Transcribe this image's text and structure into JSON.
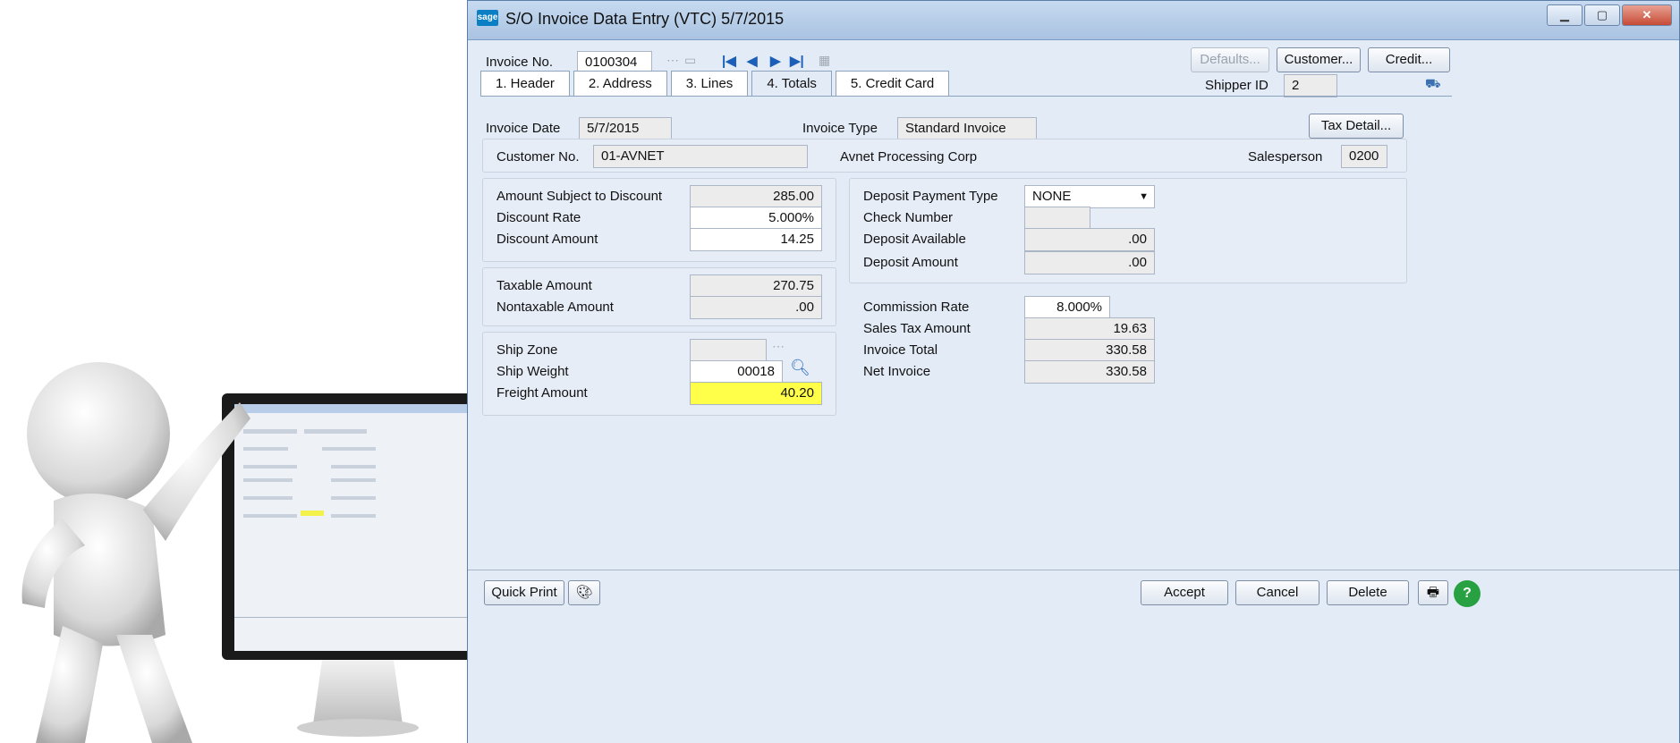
{
  "window": {
    "logo": "sage",
    "title": "S/O Invoice Data Entry (VTC) 5/7/2015",
    "minimize_icon": "minimize-icon",
    "maximize_icon": "maximize-icon",
    "close_icon": "close-icon"
  },
  "invoice": {
    "label": "Invoice No.",
    "value": "0100304"
  },
  "buttons": {
    "defaults": "Defaults...",
    "customer": "Customer...",
    "credit": "Credit...",
    "tax_detail": "Tax Detail..."
  },
  "shipper": {
    "label": "Shipper ID",
    "value": "2"
  },
  "tabs": [
    {
      "label": "1. Header"
    },
    {
      "label": "2. Address"
    },
    {
      "label": "3. Lines"
    },
    {
      "label": "4. Totals",
      "active": true
    },
    {
      "label": "5. Credit Card"
    }
  ],
  "header_info": {
    "invoice_date_label": "Invoice Date",
    "invoice_date": "5/7/2015",
    "invoice_type_label": "Invoice Type",
    "invoice_type": "Standard Invoice",
    "customer_no_label": "Customer No.",
    "customer_no": "01-AVNET",
    "customer_name": "Avnet Processing Corp",
    "salesperson_label": "Salesperson",
    "salesperson": "0200"
  },
  "discount": {
    "amount_subject_label": "Amount Subject to Discount",
    "amount_subject": "285.00",
    "rate_label": "Discount Rate",
    "rate": "5.000%",
    "amount_label": "Discount Amount",
    "amount": "14.25"
  },
  "taxable": {
    "taxable_label": "Taxable Amount",
    "taxable": "270.75",
    "nontaxable_label": "Nontaxable Amount",
    "nontaxable": ".00"
  },
  "ship": {
    "zone_label": "Ship Zone",
    "zone": "",
    "weight_label": "Ship Weight",
    "weight": "00018",
    "freight_label": "Freight Amount",
    "freight": "40.20"
  },
  "deposit": {
    "payment_type_label": "Deposit Payment Type",
    "payment_type": "NONE",
    "check_number_label": "Check Number",
    "check_number": "",
    "available_label": "Deposit Available",
    "available": ".00",
    "amount_label": "Deposit Amount",
    "amount": ".00"
  },
  "totals": {
    "commission_rate_label": "Commission Rate",
    "commission_rate": "8.000%",
    "sales_tax_label": "Sales Tax Amount",
    "sales_tax": "19.63",
    "invoice_total_label": "Invoice Total",
    "invoice_total": "330.58",
    "net_invoice_label": "Net Invoice",
    "net_invoice": "330.58"
  },
  "footer": {
    "quick_print": "Quick Print",
    "accept": "Accept",
    "cancel": "Cancel",
    "delete": "Delete"
  },
  "colors": {
    "freight_highlight": "#ffff4a",
    "title_bar": "#b7cde8",
    "panel_bg": "#e3ebf6"
  }
}
